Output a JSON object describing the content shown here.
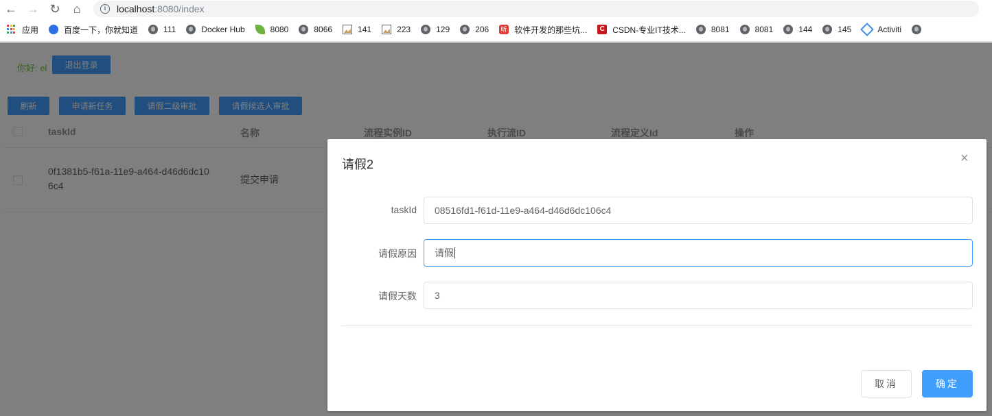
{
  "browser": {
    "url_host": "localhost",
    "url_path": ":8080/index",
    "bookmarks": [
      {
        "label": "应用",
        "icon": "apps-grid-icon"
      },
      {
        "label": "百度一下，你就知道",
        "icon": "baidu-paw-icon"
      },
      {
        "label": "111",
        "icon": "globe-icon"
      },
      {
        "label": "Docker Hub",
        "icon": "globe-icon"
      },
      {
        "label": "8080",
        "icon": "spring-leaf-icon"
      },
      {
        "label": "8066",
        "icon": "globe-icon"
      },
      {
        "label": "141",
        "icon": "image-icon"
      },
      {
        "label": "223",
        "icon": "image-icon"
      },
      {
        "label": "129",
        "icon": "globe-icon"
      },
      {
        "label": "206",
        "icon": "globe-icon"
      },
      {
        "label": "软件开发的那些坑...",
        "icon": "ting-icon",
        "glyph": "听"
      },
      {
        "label": "CSDN-专业IT技术...",
        "icon": "csdn-icon",
        "glyph": "C"
      },
      {
        "label": "8081",
        "icon": "globe-icon"
      },
      {
        "label": "8081",
        "icon": "globe-icon"
      },
      {
        "label": "144",
        "icon": "globe-icon"
      },
      {
        "label": "145",
        "icon": "globe-icon"
      },
      {
        "label": "Activiti",
        "icon": "activiti-icon"
      }
    ]
  },
  "header": {
    "greeting": "你好: el",
    "logout_label": "退出登录"
  },
  "toolbar": {
    "refresh_label": "刷新",
    "new_task_label": "申请新任务",
    "level2_label": "请假二级审批",
    "candidate_label": "请假候选人审批"
  },
  "table": {
    "columns": [
      "taskId",
      "名称",
      "流程实例ID",
      "执行流ID",
      "流程定义Id",
      "操作"
    ],
    "rows": [
      {
        "task_id_line1": "0f1381b5-f61a-11e9-a464-d46d6dc10",
        "task_id_line2": "6c4",
        "name": "提交申请"
      }
    ]
  },
  "dialog": {
    "title": "请假2",
    "close_glyph": "×",
    "fields": [
      {
        "label": "taskId",
        "value": "08516fd1-f61d-11e9-a464-d46d6dc106c4"
      },
      {
        "label": "请假原因",
        "value": "请假"
      },
      {
        "label": "请假天数",
        "value": "3"
      }
    ],
    "cancel_label": "取消",
    "confirm_label": "确定"
  },
  "colors": {
    "primary": "#409eff",
    "success_text": "#67c23a",
    "overlay": "rgba(0,0,0,0.5)"
  }
}
